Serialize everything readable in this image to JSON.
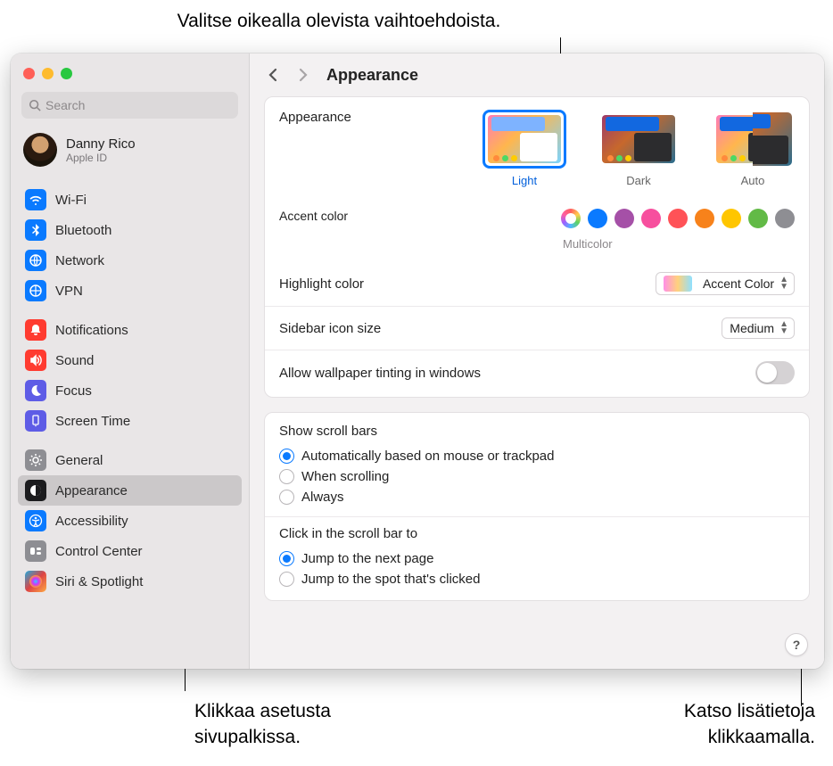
{
  "callouts": {
    "top": "Valitse oikealla olevista vaihtoehdoista.",
    "bottom_left_l1": "Klikkaa asetusta",
    "bottom_left_l2": "sivupalkissa.",
    "bottom_right_l1": "Katso lisätietoja",
    "bottom_right_l2": "klikkaamalla."
  },
  "search": {
    "placeholder": "Search"
  },
  "profile": {
    "name": "Danny Rico",
    "sub": "Apple ID"
  },
  "sidebar": {
    "group1": [
      {
        "label": "Wi-Fi",
        "color": "#0a7aff",
        "name": "wifi"
      },
      {
        "label": "Bluetooth",
        "color": "#0a7aff",
        "name": "bluetooth"
      },
      {
        "label": "Network",
        "color": "#0a7aff",
        "name": "network"
      },
      {
        "label": "VPN",
        "color": "#0a7aff",
        "name": "vpn"
      }
    ],
    "group2": [
      {
        "label": "Notifications",
        "color": "#ff3b30",
        "name": "notifications"
      },
      {
        "label": "Sound",
        "color": "#ff3b30",
        "name": "sound"
      },
      {
        "label": "Focus",
        "color": "#5e5ce6",
        "name": "focus"
      },
      {
        "label": "Screen Time",
        "color": "#5e5ce6",
        "name": "screen-time"
      }
    ],
    "group3": [
      {
        "label": "General",
        "color": "#8e8e93",
        "name": "general"
      },
      {
        "label": "Appearance",
        "color": "#1c1c1e",
        "name": "appearance",
        "selected": true
      },
      {
        "label": "Accessibility",
        "color": "#0a7aff",
        "name": "accessibility"
      },
      {
        "label": "Control Center",
        "color": "#8e8e93",
        "name": "control-center"
      },
      {
        "label": "Siri & Spotlight",
        "color": "linear",
        "name": "siri"
      }
    ]
  },
  "page": {
    "title": "Appearance",
    "appearance_label": "Appearance",
    "themes": [
      {
        "label": "Light",
        "name": "light",
        "selected": true
      },
      {
        "label": "Dark",
        "name": "dark"
      },
      {
        "label": "Auto",
        "name": "auto"
      }
    ],
    "accent_label": "Accent color",
    "accent_selected": "Multicolor",
    "accent_colors": [
      "multi",
      "#0a7aff",
      "#a550a7",
      "#f74f9e",
      "#ff5257",
      "#f7821b",
      "#ffc600",
      "#62ba46",
      "#8e8e93"
    ],
    "highlight_label": "Highlight color",
    "highlight_value": "Accent Color",
    "sidebar_size_label": "Sidebar icon size",
    "sidebar_size_value": "Medium",
    "wallpaper_label": "Allow wallpaper tinting in windows",
    "scroll_title": "Show scroll bars",
    "scroll_opts": [
      "Automatically based on mouse or trackpad",
      "When scrolling",
      "Always"
    ],
    "scroll_selected": 0,
    "click_title": "Click in the scroll bar to",
    "click_opts": [
      "Jump to the next page",
      "Jump to the spot that's clicked"
    ],
    "click_selected": 0,
    "help": "?"
  }
}
